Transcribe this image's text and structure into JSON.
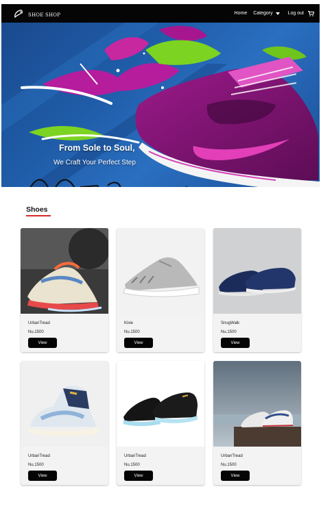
{
  "nav": {
    "brand": "SHOE SHOP",
    "home": "Home",
    "category": "Category",
    "logout": "Log out",
    "cart_icon": "cart-icon"
  },
  "hero": {
    "title": "From Sole to Soul,",
    "subtitle": "We Craft Your Perfect Step"
  },
  "section": {
    "title": "Shoes",
    "accent": "#d6282b"
  },
  "products": [
    {
      "name": "UrbanTread",
      "price": "Nu.1500",
      "button": "View"
    },
    {
      "name": "Kixie",
      "price": "Nu.1500",
      "button": "View"
    },
    {
      "name": "SnugWalk",
      "price": "Nu.1500",
      "button": "View"
    },
    {
      "name": "UrbanTread",
      "price": "Nu.1500",
      "button": "View"
    },
    {
      "name": "UrbanTread",
      "price": "Nu.1500",
      "button": "View"
    },
    {
      "name": "UrbanTread",
      "price": "Nu.1500",
      "button": "View"
    }
  ]
}
